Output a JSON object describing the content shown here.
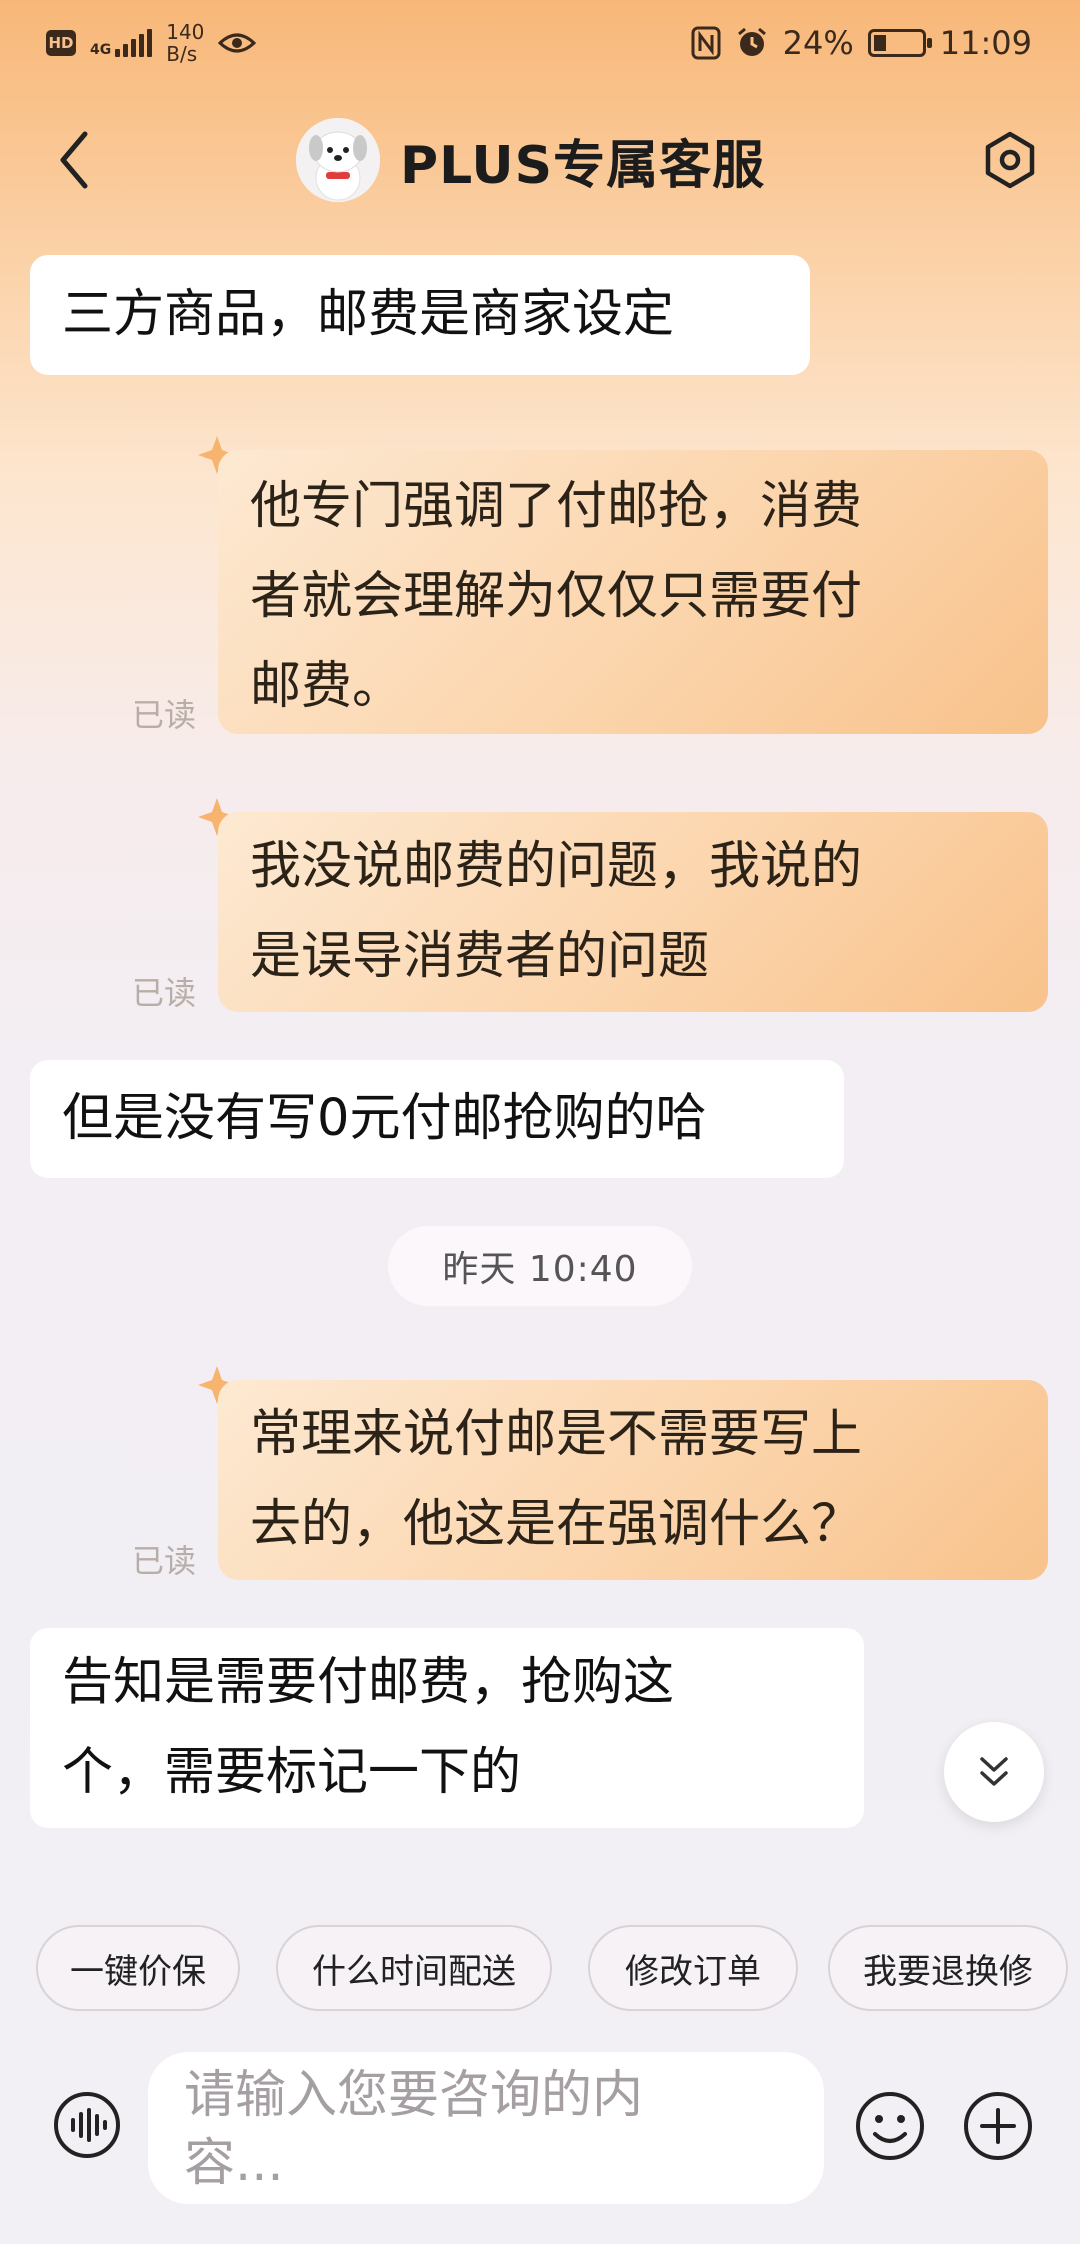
{
  "status_bar": {
    "network_badge": "HD",
    "network_type": "4G",
    "speed_value": "140",
    "speed_unit": "B/s",
    "battery": "24%",
    "time": "11:09"
  },
  "header": {
    "title": "PLUS专属客服"
  },
  "messages": [
    {
      "side": "left",
      "text": "三方商品，邮费是商家设定"
    },
    {
      "side": "right",
      "lines": [
        "他专门强调了付邮抢，消费",
        "者就会理解为仅仅只需要付",
        "邮费。"
      ],
      "read": "已读"
    },
    {
      "side": "right",
      "lines": [
        "我没说邮费的问题，我说的",
        "是误导消费者的问题"
      ],
      "read": "已读"
    },
    {
      "side": "left",
      "text": "但是没有写0元付邮抢购的哈"
    },
    {
      "side": "right",
      "lines": [
        "常理来说付邮是不需要写上",
        "去的，他这是在强调什么？"
      ],
      "read": "已读"
    },
    {
      "side": "left",
      "lines": [
        "告知是需要付邮费，抢购这",
        "个，需要标记一下的"
      ]
    }
  ],
  "timestamp": "昨天  10:40",
  "quick_replies": [
    "一键价保",
    "什么时间配送",
    "修改订单",
    "我要退换修"
  ],
  "input": {
    "placeholder_line1": "请输入您要咨询的内",
    "placeholder_line2": "容..."
  },
  "colors": {
    "header_gradient_top": "#f8b778",
    "user_bubble": "#fbd3a9",
    "agent_bubble": "#ffffff",
    "read_text": "#b8aea8"
  },
  "icons": [
    "back-arrow-icon",
    "mascot-avatar",
    "settings-icon",
    "star-icon",
    "double-chevron-down-icon",
    "voice-icon",
    "emoji-icon",
    "plus-icon"
  ]
}
